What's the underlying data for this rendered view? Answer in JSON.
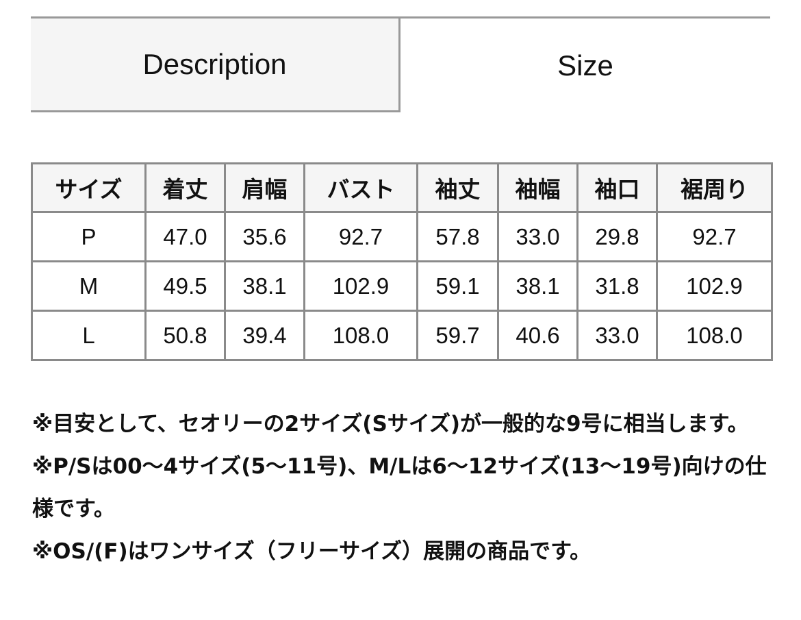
{
  "tabs": [
    {
      "label": "Description",
      "active": false
    },
    {
      "label": "Size",
      "active": true
    }
  ],
  "size_table": {
    "headers": [
      "サイズ",
      "着丈",
      "肩幅",
      "バスト",
      "袖丈",
      "袖幅",
      "袖口",
      "裾周り"
    ],
    "rows": [
      [
        "P",
        "47.0",
        "35.6",
        "92.7",
        "57.8",
        "33.0",
        "29.8",
        "92.7"
      ],
      [
        "M",
        "49.5",
        "38.1",
        "102.9",
        "59.1",
        "38.1",
        "31.8",
        "102.9"
      ],
      [
        "L",
        "50.8",
        "39.4",
        "108.0",
        "59.7",
        "40.6",
        "33.0",
        "108.0"
      ]
    ]
  },
  "notes": [
    "※目安として、セオリーの2サイズ(Sサイズ)が一般的な9号に相当します。",
    "※P/Sは00〜4サイズ(5〜11号)、M/Lは6〜12サイズ(13〜19号)向けの仕様です。",
    "※OS/(F)はワンサイズ（フリーサイズ）展開の商品です。"
  ],
  "colors": {
    "border": "#999999",
    "inactive_tab_bg": "#f5f5f5",
    "header_bg": "#f5f5f5"
  }
}
